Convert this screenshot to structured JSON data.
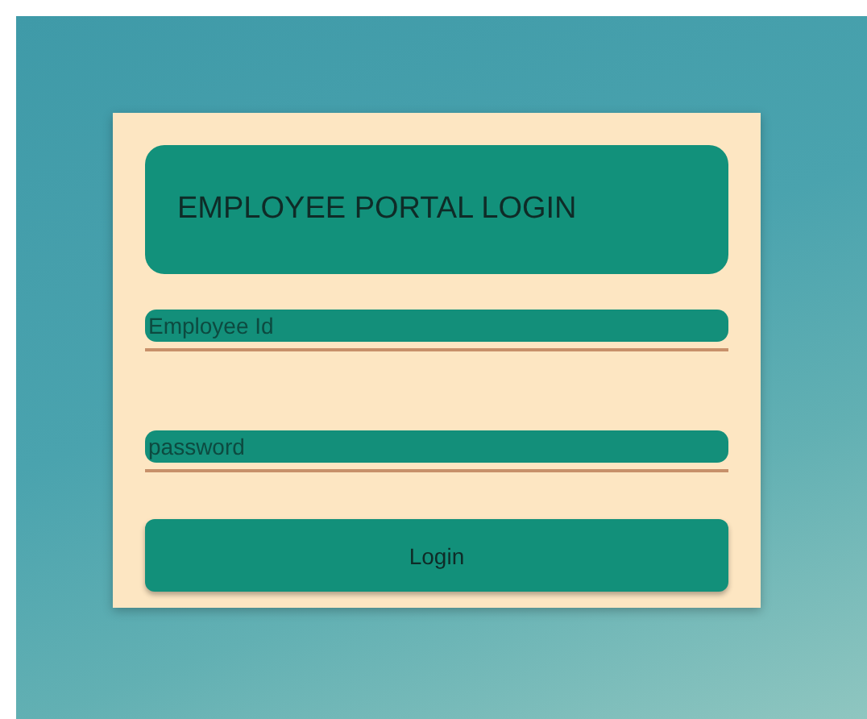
{
  "title": "EMPLOYEE PORTAL LOGIN",
  "fields": [
    {
      "placeholder": "Employee Id"
    },
    {
      "placeholder": "password"
    }
  ],
  "login_button": "Login"
}
